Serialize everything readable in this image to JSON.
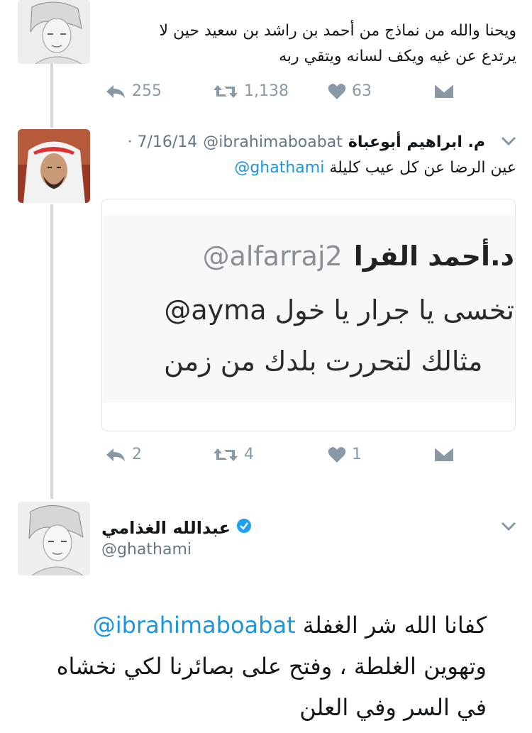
{
  "tweet1": {
    "text_line1": "ويحنا والله من نماذج من أحمد بن راشد بن سعيد حين لا",
    "text_line2": "يرتدع عن غيه ويكف لسانه ويتقي ربه",
    "replies": "255",
    "retweets": "1,138",
    "likes": "63"
  },
  "tweet2": {
    "name": "م. ابراهيم أبوعباة",
    "handle": "@ibrahimaboabat",
    "date": "· 7/16/14",
    "mention": "@ghathami",
    "text": "عين الرضا عن كل عيب كليلة",
    "image": {
      "name": "د.أحمد الفرا",
      "handle": "@alfarraj2",
      "line2_mention": "@ayma",
      "line2_text": "تخسى يا جرار يا خول",
      "line3": "مثالك لتحررت بلدك من زمن"
    },
    "replies": "2",
    "retweets": "4",
    "likes": "1"
  },
  "tweet3": {
    "name": "عبدالله الغذامي",
    "handle": "@ghathami",
    "mention": "@ibrahimaboabat",
    "line1": "كفانا الله شر الغفلة",
    "line2": "وتهوين الغلطة ، وفتح على بصائرنا لكي نخشاه",
    "line3": "في السر وفي العلن"
  },
  "colors": {
    "link": "#1b95e0",
    "icon_gray": "#8899a6",
    "verified": "#1da1f2"
  },
  "icons": [
    "reply-icon",
    "retweet-icon",
    "like-icon",
    "dm-icon",
    "chevron-down-icon",
    "verified-badge-icon"
  ]
}
